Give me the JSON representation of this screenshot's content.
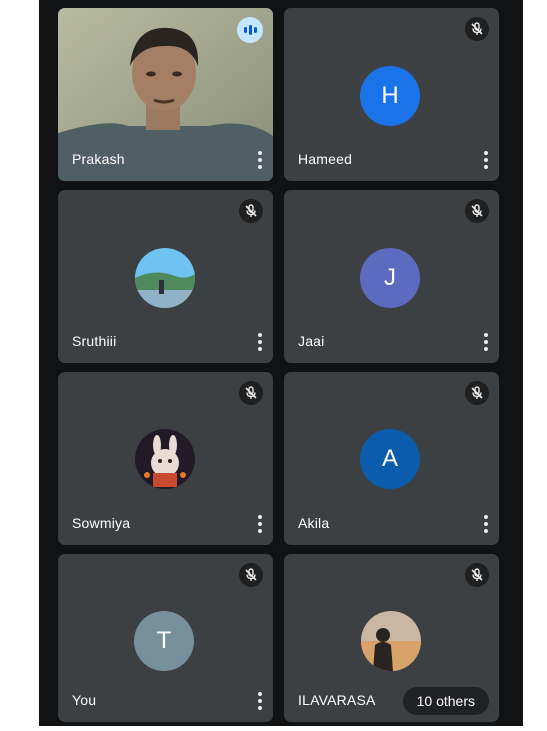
{
  "participants": [
    {
      "name": "Prakash",
      "speaking": true
    },
    {
      "name": "Hameed",
      "initial": "H",
      "avatar_color": "#1a73e8",
      "muted": true
    },
    {
      "name": "Sruthiii",
      "muted": true
    },
    {
      "name": "Jaai",
      "initial": "J",
      "avatar_color": "#5c6bc0",
      "muted": true
    },
    {
      "name": "Sowmiya",
      "muted": true
    },
    {
      "name": "Akila",
      "initial": "A",
      "avatar_color": "#0b5cad",
      "muted": true
    },
    {
      "name": "You",
      "initial": "T",
      "avatar_color": "#78909c",
      "muted": true
    },
    {
      "name": "ILAVARASA",
      "muted": true
    }
  ],
  "others_label": "10 others",
  "colors": {
    "tile": "#3c4043",
    "background": "#111214",
    "active_outline": "#a8c7fa"
  }
}
